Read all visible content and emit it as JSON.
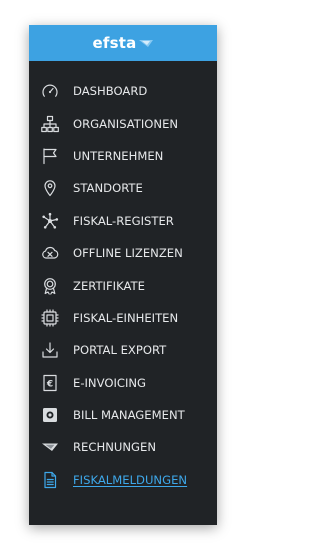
{
  "brand": {
    "name": "efsta",
    "color": "#3da2e2"
  },
  "menu": {
    "active_color": "#3ea8ea",
    "items": [
      {
        "label": "DASHBOARD",
        "icon": "gauge-icon"
      },
      {
        "label": "ORGANISATIONEN",
        "icon": "org-chart-icon"
      },
      {
        "label": "UNTERNEHMEN",
        "icon": "flag-icon"
      },
      {
        "label": "STANDORTE",
        "icon": "map-pin-icon"
      },
      {
        "label": "FISKAL-REGISTER",
        "icon": "network-hub-icon"
      },
      {
        "label": "OFFLINE LIZENZEN",
        "icon": "cloud-offline-icon"
      },
      {
        "label": "ZERTIFIKATE",
        "icon": "award-icon"
      },
      {
        "label": "FISKAL-EINHEITEN",
        "icon": "chip-icon"
      },
      {
        "label": "PORTAL EXPORT",
        "icon": "download-tray-icon"
      },
      {
        "label": "E-INVOICING",
        "icon": "e-invoice-icon"
      },
      {
        "label": "BILL MANAGEMENT",
        "icon": "bill-icon"
      },
      {
        "label": "RECHNUNGEN",
        "icon": "brand-wing-icon"
      },
      {
        "label": "FISKALMELDUNGEN",
        "icon": "document-icon",
        "active": true
      }
    ]
  }
}
